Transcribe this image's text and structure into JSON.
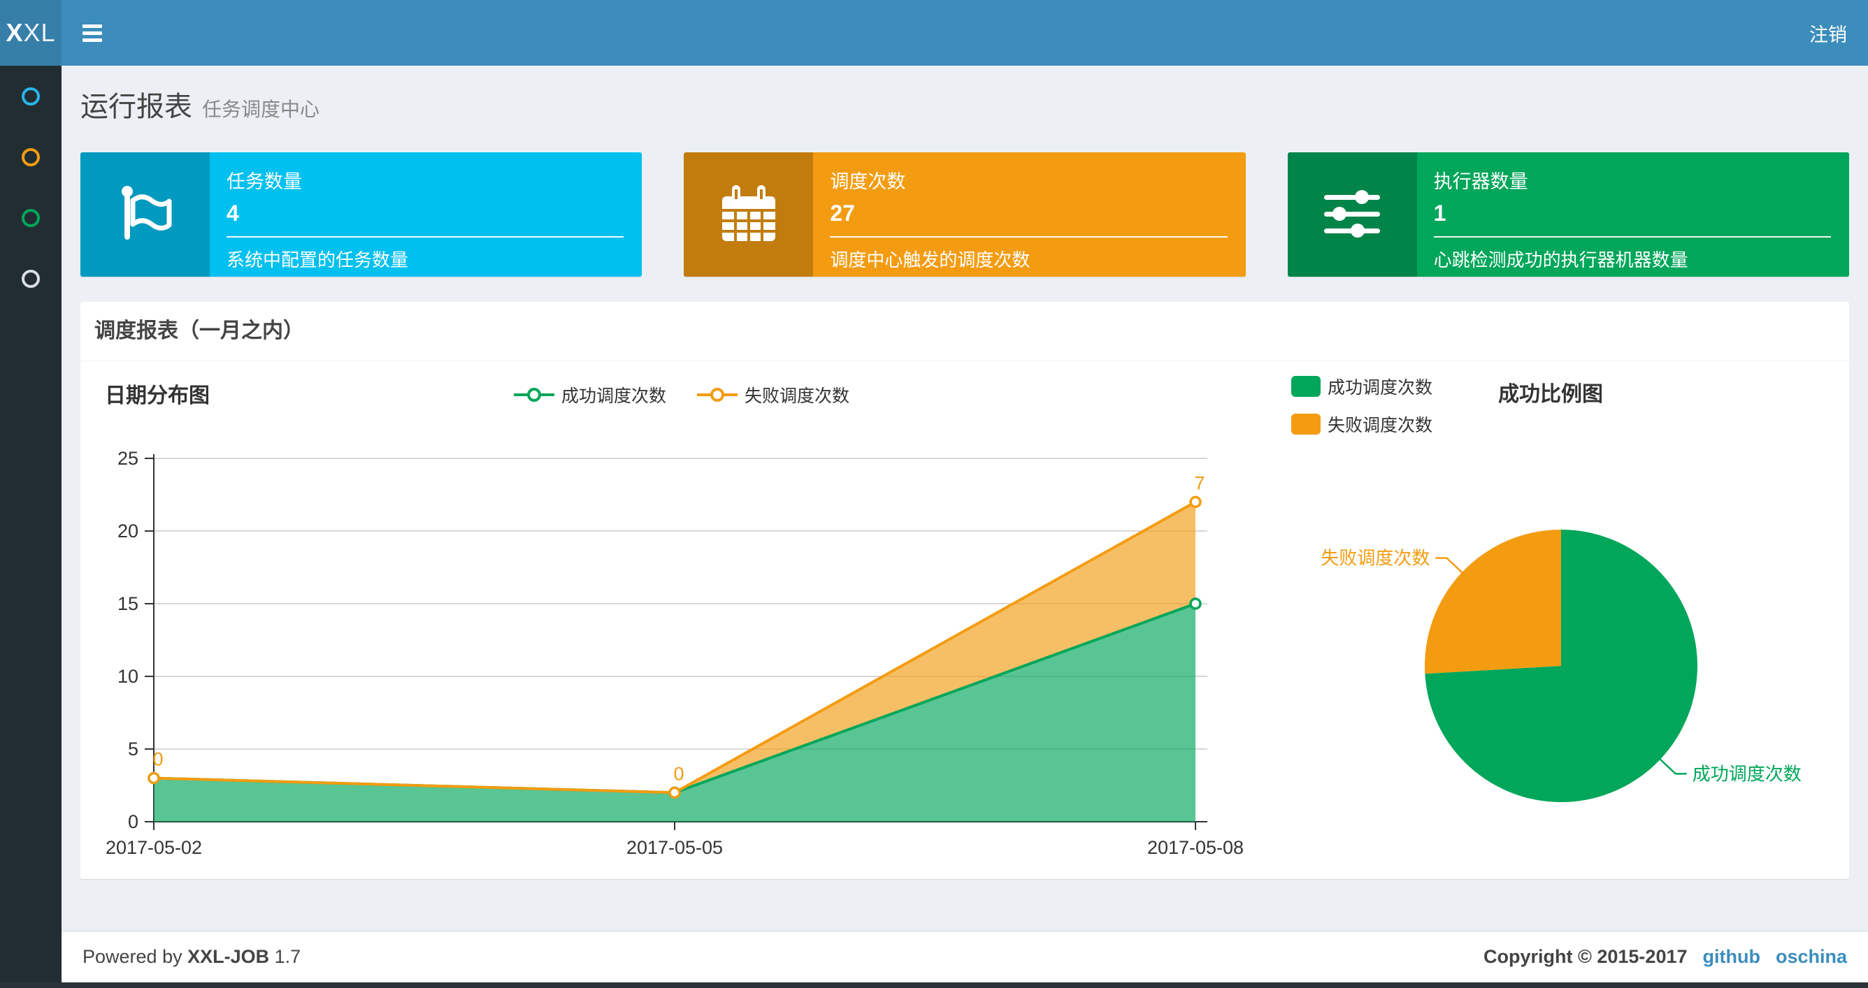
{
  "header": {
    "logo_bold": "X",
    "logo_rest": "XL",
    "logout_label": "注销"
  },
  "sidebar": {
    "items": [
      {
        "name": "menu-1",
        "color": "#29b5e8"
      },
      {
        "name": "menu-2",
        "color": "#f39c12"
      },
      {
        "name": "menu-3",
        "color": "#00a65a"
      },
      {
        "name": "menu-4",
        "color": "#d8dce3"
      }
    ]
  },
  "page": {
    "title": "运行报表",
    "subtitle": "任务调度中心"
  },
  "stats": [
    {
      "label": "任务数量",
      "value": "4",
      "desc": "系统中配置的任务数量",
      "color": "#00c0ef",
      "icon": "flag-icon"
    },
    {
      "label": "调度次数",
      "value": "27",
      "desc": "调度中心触发的调度次数",
      "color": "#f39c12",
      "icon": "calendar-icon"
    },
    {
      "label": "执行器数量",
      "value": "1",
      "desc": "心跳检测成功的执行器机器数量",
      "color": "#00a65a",
      "icon": "sliders-icon"
    }
  ],
  "panel": {
    "title": "调度报表（一月之内）"
  },
  "chart_data": [
    {
      "type": "area",
      "title": "日期分布图",
      "categories": [
        "2017-05-02",
        "2017-05-05",
        "2017-05-08"
      ],
      "stacked": true,
      "series": [
        {
          "name": "成功调度次数",
          "values": [
            3,
            2,
            15
          ],
          "color": "#00a65a"
        },
        {
          "name": "失败调度次数",
          "values": [
            0,
            0,
            7
          ],
          "color": "#f39c12"
        }
      ],
      "data_labels": {
        "series": "失败调度次数",
        "values": [
          "0",
          "0",
          "7"
        ]
      },
      "xlabel": "",
      "ylabel": "",
      "ylim": [
        0,
        25
      ],
      "ytick_step": 5,
      "grid": "horizontal",
      "legend_position": "top-center"
    },
    {
      "type": "pie",
      "title": "成功比例图",
      "labels": [
        "成功调度次数",
        "失败调度次数"
      ],
      "values": [
        20,
        7
      ],
      "colors": [
        "#00a65a",
        "#f39c12"
      ],
      "legend_position": "top-left",
      "start_angle_deg": -90,
      "direction": "clockwise"
    }
  ],
  "footer": {
    "powered_prefix": "Powered by",
    "product": "XXL-JOB",
    "version": "1.7",
    "copyright": "Copyright © 2015-2017",
    "links": [
      "github",
      "oschina"
    ]
  }
}
